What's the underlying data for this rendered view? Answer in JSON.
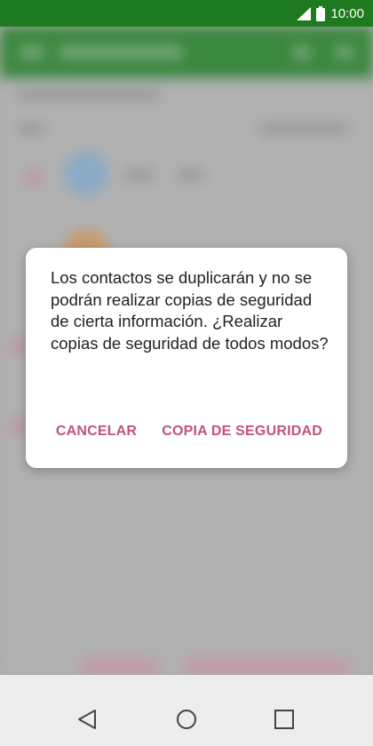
{
  "status_bar": {
    "time": "10:00",
    "icons": [
      "signal-icon",
      "battery-icon"
    ]
  },
  "dialog": {
    "message": "Los contactos se duplicarán y no se podrán realizar copias de seguridad de cierta información. ¿Realizar copias de seguridad de todos modos?",
    "cancel_label": "CANCELAR",
    "confirm_label": "COPIA DE SEGURIDAD"
  },
  "nav_bar": {
    "icons": [
      "back-icon",
      "home-icon",
      "recents-icon"
    ]
  },
  "colors": {
    "status_bar": "#1e7a1e",
    "app_header": "#2e8b33",
    "dialog_button": "#c2537a",
    "nav_bar": "#ededed"
  }
}
